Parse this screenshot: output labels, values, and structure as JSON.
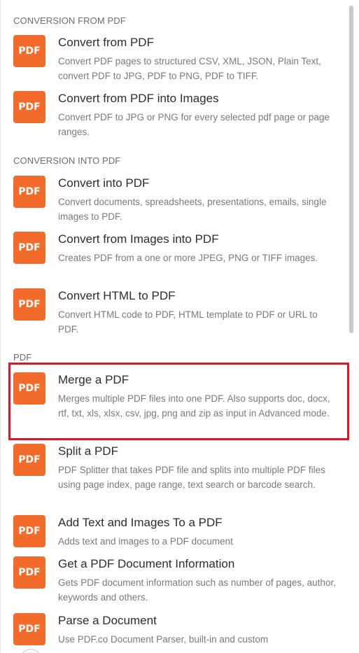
{
  "sections": {
    "conversion_from": {
      "title": "CONVERSION FROM PDF"
    },
    "conversion_into": {
      "title": "CONVERSION INTO PDF"
    },
    "pdf": {
      "title": "PDF"
    }
  },
  "badge_label": "PDF",
  "items": [
    {
      "title": "Convert from PDF",
      "desc": "Convert PDF pages to structured CSV, XML, JSON, Plain Text, convert PDF to JPG, PDF to PNG, PDF to TIFF."
    },
    {
      "title": "Convert from PDF into Images",
      "desc": "Convert PDF to JPG or PNG for every selected pdf page or page ranges."
    },
    {
      "title": "Convert into PDF",
      "desc": "Convert documents, spreadsheets, presentations, emails, single images to PDF."
    },
    {
      "title": "Convert from Images into PDF",
      "desc": "Creates PDF from a one or more JPEG, PNG or TIFF images."
    },
    {
      "title": "Convert HTML to PDF",
      "desc": "Convert HTML code to PDF, HTML template to PDF or URL to PDF."
    },
    {
      "title": "Merge a PDF",
      "desc": "Merges multiple PDF files into one PDF. Also supports doc, docx, rtf, txt, xls, xlsx, csv, jpg, png and zip as input in Advanced mode."
    },
    {
      "title": "Split a PDF",
      "desc": "PDF Splitter that takes PDF file and splits into multiple PDF files using page index, page range, text search or barcode search."
    },
    {
      "title": "Add Text and Images To a PDF",
      "desc": "Adds text and images to a PDF document"
    },
    {
      "title": "Get a PDF Document Information",
      "desc": "Gets PDF document information such as number of pages, author, keywords and others."
    },
    {
      "title": "Parse a Document",
      "desc": "Use PDF.co Document Parser, built-in and custom"
    }
  ],
  "colors": {
    "badge": "#f26b2a",
    "highlight": "#e0142a"
  },
  "icons": {
    "item_badge": "pdf-icon"
  }
}
